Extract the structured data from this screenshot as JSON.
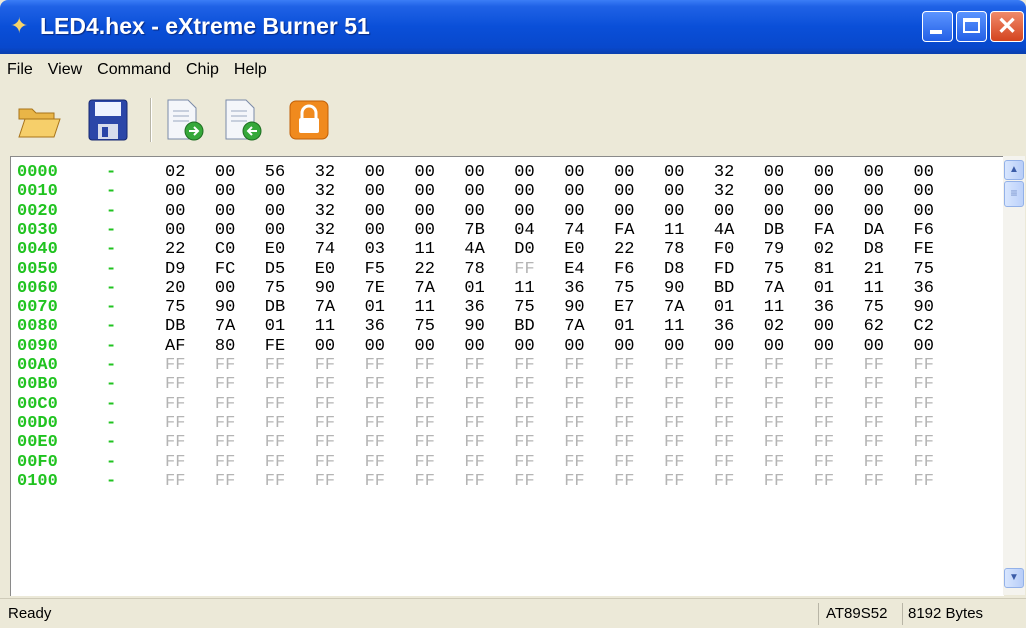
{
  "window": {
    "title": "LED4.hex - eXtreme Burner 51",
    "app_icon": "flame-icon"
  },
  "menu": [
    "File",
    "View",
    "Command",
    "Chip",
    "Help"
  ],
  "toolbar": {
    "buttons": [
      {
        "name": "open-icon"
      },
      {
        "name": "save-icon"
      },
      {
        "name": "read-chip-icon"
      },
      {
        "name": "write-chip-icon"
      },
      {
        "name": "lock-icon"
      }
    ]
  },
  "hex": {
    "dash": "-",
    "rows": [
      {
        "addr": "0000",
        "bytes": [
          "02",
          "00",
          "56",
          "32",
          "00",
          "00",
          "00",
          "00",
          "00",
          "00",
          "00",
          "32",
          "00",
          "00",
          "00",
          "00"
        ]
      },
      {
        "addr": "0010",
        "bytes": [
          "00",
          "00",
          "00",
          "32",
          "00",
          "00",
          "00",
          "00",
          "00",
          "00",
          "00",
          "32",
          "00",
          "00",
          "00",
          "00"
        ]
      },
      {
        "addr": "0020",
        "bytes": [
          "00",
          "00",
          "00",
          "32",
          "00",
          "00",
          "00",
          "00",
          "00",
          "00",
          "00",
          "00",
          "00",
          "00",
          "00",
          "00"
        ]
      },
      {
        "addr": "0030",
        "bytes": [
          "00",
          "00",
          "00",
          "32",
          "00",
          "00",
          "7B",
          "04",
          "74",
          "FA",
          "11",
          "4A",
          "DB",
          "FA",
          "DA",
          "F6"
        ]
      },
      {
        "addr": "0040",
        "bytes": [
          "22",
          "C0",
          "E0",
          "74",
          "03",
          "11",
          "4A",
          "D0",
          "E0",
          "22",
          "78",
          "F0",
          "79",
          "02",
          "D8",
          "FE"
        ]
      },
      {
        "addr": "0050",
        "bytes": [
          "D9",
          "FC",
          "D5",
          "E0",
          "F5",
          "22",
          "78",
          "FF",
          "E4",
          "F6",
          "D8",
          "FD",
          "75",
          "81",
          "21",
          "75"
        ]
      },
      {
        "addr": "0060",
        "bytes": [
          "20",
          "00",
          "75",
          "90",
          "7E",
          "7A",
          "01",
          "11",
          "36",
          "75",
          "90",
          "BD",
          "7A",
          "01",
          "11",
          "36"
        ]
      },
      {
        "addr": "0070",
        "bytes": [
          "75",
          "90",
          "DB",
          "7A",
          "01",
          "11",
          "36",
          "75",
          "90",
          "E7",
          "7A",
          "01",
          "11",
          "36",
          "75",
          "90"
        ]
      },
      {
        "addr": "0080",
        "bytes": [
          "DB",
          "7A",
          "01",
          "11",
          "36",
          "75",
          "90",
          "BD",
          "7A",
          "01",
          "11",
          "36",
          "02",
          "00",
          "62",
          "C2"
        ]
      },
      {
        "addr": "0090",
        "bytes": [
          "AF",
          "80",
          "FE",
          "00",
          "00",
          "00",
          "00",
          "00",
          "00",
          "00",
          "00",
          "00",
          "00",
          "00",
          "00",
          "00"
        ]
      },
      {
        "addr": "00A0",
        "bytes": [
          "FF",
          "FF",
          "FF",
          "FF",
          "FF",
          "FF",
          "FF",
          "FF",
          "FF",
          "FF",
          "FF",
          "FF",
          "FF",
          "FF",
          "FF",
          "FF"
        ]
      },
      {
        "addr": "00B0",
        "bytes": [
          "FF",
          "FF",
          "FF",
          "FF",
          "FF",
          "FF",
          "FF",
          "FF",
          "FF",
          "FF",
          "FF",
          "FF",
          "FF",
          "FF",
          "FF",
          "FF"
        ]
      },
      {
        "addr": "00C0",
        "bytes": [
          "FF",
          "FF",
          "FF",
          "FF",
          "FF",
          "FF",
          "FF",
          "FF",
          "FF",
          "FF",
          "FF",
          "FF",
          "FF",
          "FF",
          "FF",
          "FF"
        ]
      },
      {
        "addr": "00D0",
        "bytes": [
          "FF",
          "FF",
          "FF",
          "FF",
          "FF",
          "FF",
          "FF",
          "FF",
          "FF",
          "FF",
          "FF",
          "FF",
          "FF",
          "FF",
          "FF",
          "FF"
        ]
      },
      {
        "addr": "00E0",
        "bytes": [
          "FF",
          "FF",
          "FF",
          "FF",
          "FF",
          "FF",
          "FF",
          "FF",
          "FF",
          "FF",
          "FF",
          "FF",
          "FF",
          "FF",
          "FF",
          "FF"
        ]
      },
      {
        "addr": "00F0",
        "bytes": [
          "FF",
          "FF",
          "FF",
          "FF",
          "FF",
          "FF",
          "FF",
          "FF",
          "FF",
          "FF",
          "FF",
          "FF",
          "FF",
          "FF",
          "FF",
          "FF"
        ]
      },
      {
        "addr": "0100",
        "bytes": [
          "FF",
          "FF",
          "FF",
          "FF",
          "FF",
          "FF",
          "FF",
          "FF",
          "FF",
          "FF",
          "FF",
          "FF",
          "FF",
          "FF",
          "FF",
          "FF"
        ]
      }
    ]
  },
  "status": {
    "ready": "Ready",
    "chip": "AT89S52",
    "size": "8192 Bytes"
  },
  "colors": {
    "address": "#20c320",
    "blank_byte": "#b4b4b4",
    "titlebar": "#0a4fd8"
  }
}
